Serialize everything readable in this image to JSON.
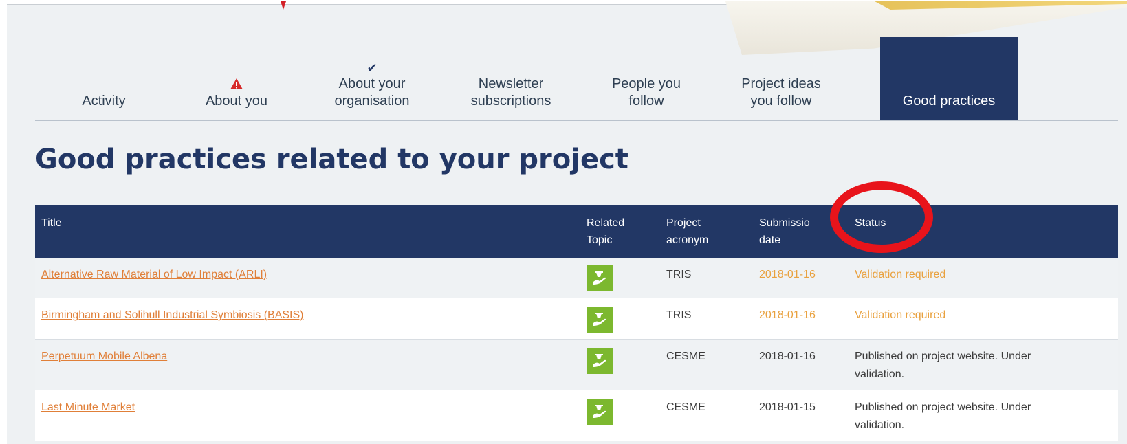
{
  "tabs": [
    {
      "label_1": "Activity",
      "label_2": "",
      "mark": "",
      "active": false
    },
    {
      "label_1": "About you",
      "label_2": "",
      "mark": "warning-icon",
      "active": false
    },
    {
      "label_1": "About your",
      "label_2": "organisation",
      "mark": "check-icon",
      "active": false
    },
    {
      "label_1": "Newsletter",
      "label_2": "subscriptions",
      "mark": "",
      "active": false
    },
    {
      "label_1": "People you",
      "label_2": "follow",
      "mark": "",
      "active": false
    },
    {
      "label_1": "Project ideas",
      "label_2": "you follow",
      "mark": "",
      "active": false
    },
    {
      "label_1": "Good practices",
      "label_2": "",
      "mark": "",
      "active": true
    }
  ],
  "page_title": "Good practices related to your project",
  "table": {
    "headers": {
      "title": "Title",
      "topic_1": "Related",
      "topic_2": "Topic",
      "acronym_1": "Project",
      "acronym_2": "acronym",
      "date_1": "Submissio",
      "date_2": "date",
      "status": "Status"
    },
    "rows": [
      {
        "title": "Alternative Raw Material of Low Impact (ARLI)",
        "topic_icon": "waste-hand-icon",
        "acronym": "TRIS",
        "date": "2018-01-16",
        "status_1": "Validation required",
        "status_2": "",
        "highlight": true
      },
      {
        "title": "Birmingham and Solihull Industrial Symbiosis (BASIS)",
        "topic_icon": "waste-hand-icon",
        "acronym": "TRIS",
        "date": "2018-01-16",
        "status_1": "Validation required",
        "status_2": "",
        "highlight": true
      },
      {
        "title": "Perpetuum Mobile Albena",
        "topic_icon": "waste-hand-icon",
        "acronym": "CESME",
        "date": "2018-01-16",
        "status_1": "Published on project website. Under",
        "status_2": "validation.",
        "highlight": false
      },
      {
        "title": "Last Minute Market",
        "topic_icon": "waste-hand-icon",
        "acronym": "CESME",
        "date": "2018-01-15",
        "status_1": "Published on project website. Under",
        "status_2": "validation.",
        "highlight": false
      }
    ]
  },
  "colors": {
    "brand_navy": "#223765",
    "link_orange": "#e07f38",
    "pending_orange": "#e9a13e",
    "topic_green": "#7cb82f",
    "annotation_red": "#e8141b"
  }
}
